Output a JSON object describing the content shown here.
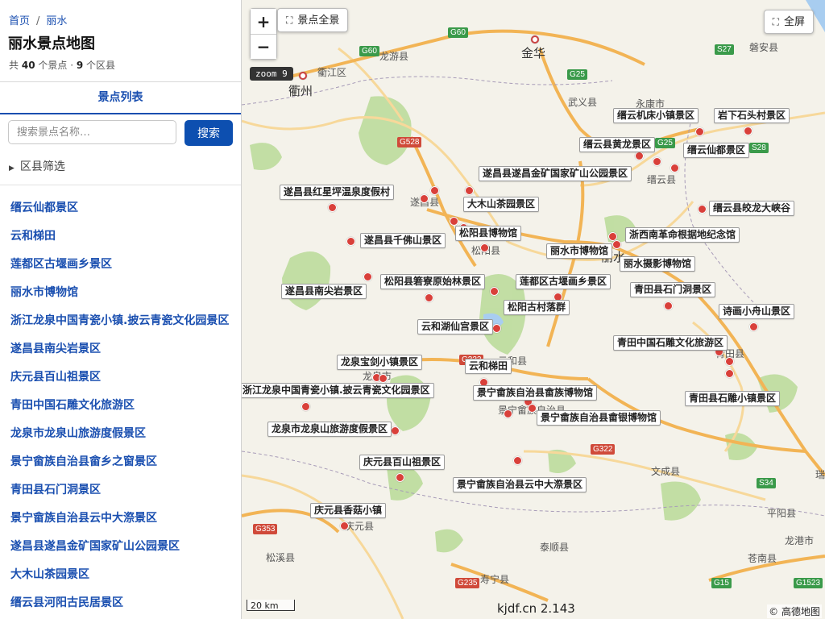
{
  "breadcrumb": {
    "home": "首页",
    "separator": "/",
    "current": "丽水"
  },
  "page_title": "丽水景点地图",
  "stats": {
    "prefix": "共",
    "spots": "40",
    "spots_unit": "个景点 ·",
    "districts": "9",
    "districts_unit": "个区县"
  },
  "tab": "景点列表",
  "search": {
    "placeholder": "搜索景点名称…",
    "button": "搜索"
  },
  "filter_label": "区县筛选",
  "spots": [
    "缙云仙都景区",
    "云和梯田",
    "莲都区古堰画乡景区",
    "丽水市博物馆",
    "浙江龙泉中国青瓷小镇.披云青瓷文化园景区",
    "遂昌县南尖岩景区",
    "庆元县百山祖景区",
    "青田中国石雕文化旅游区",
    "龙泉市龙泉山旅游度假景区",
    "景宁畲族自治县畲乡之窗景区",
    "青田县石门洞景区",
    "景宁畲族自治县云中大漈景区",
    "遂昌县遂昌金矿国家矿山公园景区",
    "大木山茶园景区",
    "缙云县河阳古民居景区"
  ],
  "map": {
    "zoom_in": "+",
    "zoom_out": "−",
    "overview_button": "景点全景",
    "fullscreen_button": "全屏",
    "zoom_badge": "zoom 9",
    "scale": "20 km",
    "watermark": "kjdf.cn 2.143",
    "attribution": "© 高德地图",
    "poi_labels": [
      "缙云机床小镇景区",
      "岩下石头村景区",
      "缙云县黄龙景区",
      "缙云仙都景区",
      "遂昌县遂昌金矿国家矿山公园景区",
      "遂昌县红星坪温泉度假村",
      "大木山茶园景区",
      "缙云县皎龙大峡谷",
      "松阳县博物馆",
      "浙西南革命根据地纪念馆",
      "遂昌县千佛山景区",
      "丽水市博物馆",
      "丽水摄影博物馆",
      "松阳县箬寮原始林景区",
      "莲都区古堰画乡景区",
      "遂昌县南尖岩景区",
      "青田县石门洞景区",
      "松阳古村落群",
      "诗画小舟山景区",
      "云和湖仙宫景区",
      "青田中国石雕文化旅游区",
      "龙泉宝剑小镇景区",
      "云和梯田",
      "浙江龙泉中国青瓷小镇.披云青瓷文化园景区",
      "景宁畲族自治县畲族博物馆",
      "青田县石雕小镇景区",
      "景宁畲族自治县畲银博物馆",
      "龙泉市龙泉山旅游度假景区",
      "庆元县百山祖景区",
      "景宁畲族自治县云中大漈景区",
      "庆元县香菇小镇"
    ],
    "places": [
      "金华",
      "衢州",
      "衢江区",
      "龙游县",
      "武义县",
      "永康市",
      "磐安县",
      "缙云县",
      "遂昌县",
      "松阳县",
      "丽水",
      "云和县",
      "龙泉市",
      "景宁畲族自治县",
      "青田县",
      "文成县",
      "泰顺县",
      "庆元县",
      "松溪县",
      "寿宁县",
      "平阳县",
      "龙港市",
      "苍南县",
      "瑞"
    ],
    "road_shields": [
      "G60",
      "G60",
      "S27",
      "G25",
      "G25",
      "G528",
      "S28",
      "G322",
      "G322",
      "S34",
      "G353",
      "G235",
      "G15",
      "G1523"
    ],
    "colors": {
      "land": "#f4f2ea",
      "forest": "#bcdc9c",
      "road_highway": "#f2b455",
      "road_major": "#f7d89a",
      "water": "#a8cdf0",
      "poi_dot": "#d9403a",
      "accent": "#1a4fb0"
    }
  }
}
